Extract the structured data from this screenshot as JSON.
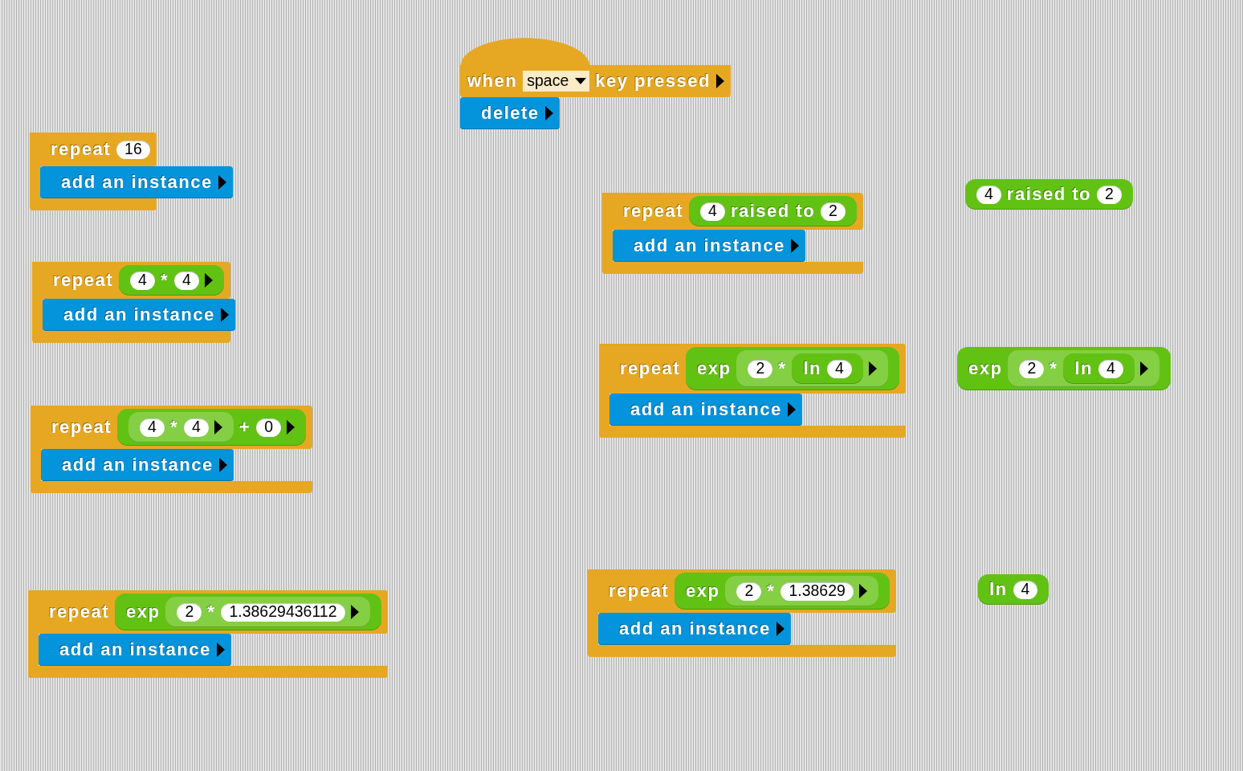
{
  "scripts": [
    {
      "blocks": [
        {
          "kind": "hat",
          "parts": [
            {
              "kind": "label",
              "text": "when"
            },
            {
              "kind": "dropdown",
              "text": "space"
            },
            {
              "kind": "label",
              "text": "key pressed"
            },
            {
              "kind": "arrows"
            }
          ]
        },
        {
          "kind": "command",
          "parts": [
            {
              "kind": "label",
              "text": "delete"
            },
            {
              "kind": "arrows"
            }
          ]
        }
      ]
    },
    {
      "blocks": [
        {
          "kind": "c",
          "parts": [
            {
              "kind": "label",
              "text": "repeat"
            },
            {
              "kind": "slot",
              "text": "16"
            }
          ],
          "body": [
            {
              "kind": "command",
              "parts": [
                {
                  "kind": "label",
                  "text": "add an instance"
                },
                {
                  "kind": "arrows"
                }
              ]
            }
          ]
        }
      ]
    },
    {
      "blocks": [
        {
          "kind": "reporter",
          "parts": [
            {
              "kind": "slot",
              "text": "4"
            },
            {
              "kind": "label",
              "text": "raised to"
            },
            {
              "kind": "slot",
              "text": "2"
            }
          ]
        }
      ]
    },
    {
      "blocks": [
        {
          "kind": "c",
          "parts": [
            {
              "kind": "label",
              "text": "repeat"
            },
            {
              "kind": "reporter",
              "parts": [
                {
                  "kind": "slot",
                  "text": "4"
                },
                {
                  "kind": "label",
                  "text": "raised to"
                },
                {
                  "kind": "slot",
                  "text": "2"
                }
              ]
            }
          ],
          "body": [
            {
              "kind": "command",
              "parts": [
                {
                  "kind": "label",
                  "text": "add an instance"
                },
                {
                  "kind": "arrows"
                }
              ]
            }
          ]
        }
      ]
    },
    {
      "blocks": [
        {
          "kind": "c",
          "parts": [
            {
              "kind": "label",
              "text": "repeat"
            },
            {
              "kind": "reporter",
              "parts": [
                {
                  "kind": "slot",
                  "text": "4"
                },
                {
                  "kind": "label",
                  "text": "*"
                },
                {
                  "kind": "slot",
                  "text": "4"
                },
                {
                  "kind": "arrows"
                }
              ]
            }
          ],
          "body": [
            {
              "kind": "command",
              "parts": [
                {
                  "kind": "label",
                  "text": "add an instance"
                },
                {
                  "kind": "arrows"
                }
              ]
            }
          ]
        }
      ]
    },
    {
      "blocks": [
        {
          "kind": "c",
          "parts": [
            {
              "kind": "label",
              "text": "repeat"
            },
            {
              "kind": "reporter",
              "parts": [
                {
                  "kind": "label",
                  "text": "exp"
                },
                {
                  "kind": "reporter",
                  "parts": [
                    {
                      "kind": "slot",
                      "text": "2"
                    },
                    {
                      "kind": "label",
                      "text": "*"
                    },
                    {
                      "kind": "reporter",
                      "parts": [
                        {
                          "kind": "label",
                          "text": "ln"
                        },
                        {
                          "kind": "slot",
                          "text": "4"
                        }
                      ]
                    },
                    {
                      "kind": "arrows"
                    }
                  ]
                }
              ]
            }
          ],
          "body": [
            {
              "kind": "command",
              "parts": [
                {
                  "kind": "label",
                  "text": "add an instance"
                },
                {
                  "kind": "arrows"
                }
              ]
            }
          ]
        }
      ]
    },
    {
      "blocks": [
        {
          "kind": "reporter",
          "parts": [
            {
              "kind": "label",
              "text": "exp"
            },
            {
              "kind": "reporter",
              "parts": [
                {
                  "kind": "slot",
                  "text": "2"
                },
                {
                  "kind": "label",
                  "text": "*"
                },
                {
                  "kind": "reporter",
                  "parts": [
                    {
                      "kind": "label",
                      "text": "ln"
                    },
                    {
                      "kind": "slot",
                      "text": "4"
                    }
                  ]
                },
                {
                  "kind": "arrows"
                }
              ]
            }
          ]
        }
      ]
    },
    {
      "blocks": [
        {
          "kind": "c",
          "parts": [
            {
              "kind": "label",
              "text": "repeat"
            },
            {
              "kind": "reporter",
              "parts": [
                {
                  "kind": "reporter",
                  "parts": [
                    {
                      "kind": "slot",
                      "text": "4"
                    },
                    {
                      "kind": "label",
                      "text": "*"
                    },
                    {
                      "kind": "slot",
                      "text": "4"
                    },
                    {
                      "kind": "arrows"
                    }
                  ]
                },
                {
                  "kind": "label",
                  "text": "+"
                },
                {
                  "kind": "slot",
                  "text": "0"
                },
                {
                  "kind": "arrows"
                }
              ]
            }
          ],
          "body": [
            {
              "kind": "command",
              "parts": [
                {
                  "kind": "label",
                  "text": "add an instance"
                },
                {
                  "kind": "arrows"
                }
              ]
            }
          ]
        }
      ]
    },
    {
      "blocks": [
        {
          "kind": "c",
          "parts": [
            {
              "kind": "label",
              "text": "repeat"
            },
            {
              "kind": "reporter",
              "parts": [
                {
                  "kind": "label",
                  "text": "exp"
                },
                {
                  "kind": "reporter",
                  "parts": [
                    {
                      "kind": "slot",
                      "text": "2"
                    },
                    {
                      "kind": "label",
                      "text": "*"
                    },
                    {
                      "kind": "slot",
                      "text": "1.38629"
                    },
                    {
                      "kind": "arrows"
                    }
                  ]
                }
              ]
            }
          ],
          "body": [
            {
              "kind": "command",
              "parts": [
                {
                  "kind": "label",
                  "text": "add an instance"
                },
                {
                  "kind": "arrows"
                }
              ]
            }
          ]
        }
      ]
    },
    {
      "blocks": [
        {
          "kind": "reporter",
          "parts": [
            {
              "kind": "label",
              "text": "ln"
            },
            {
              "kind": "slot",
              "text": "4"
            }
          ]
        }
      ]
    },
    {
      "blocks": [
        {
          "kind": "c",
          "parts": [
            {
              "kind": "label",
              "text": "repeat"
            },
            {
              "kind": "reporter",
              "parts": [
                {
                  "kind": "label",
                  "text": "exp"
                },
                {
                  "kind": "reporter",
                  "parts": [
                    {
                      "kind": "slot",
                      "text": "2"
                    },
                    {
                      "kind": "label",
                      "text": "*"
                    },
                    {
                      "kind": "slot",
                      "text": "1.38629436112"
                    },
                    {
                      "kind": "arrows"
                    }
                  ]
                }
              ]
            }
          ],
          "body": [
            {
              "kind": "command",
              "parts": [
                {
                  "kind": "label",
                  "text": "add an instance"
                },
                {
                  "kind": "arrows"
                }
              ]
            }
          ]
        }
      ]
    }
  ]
}
